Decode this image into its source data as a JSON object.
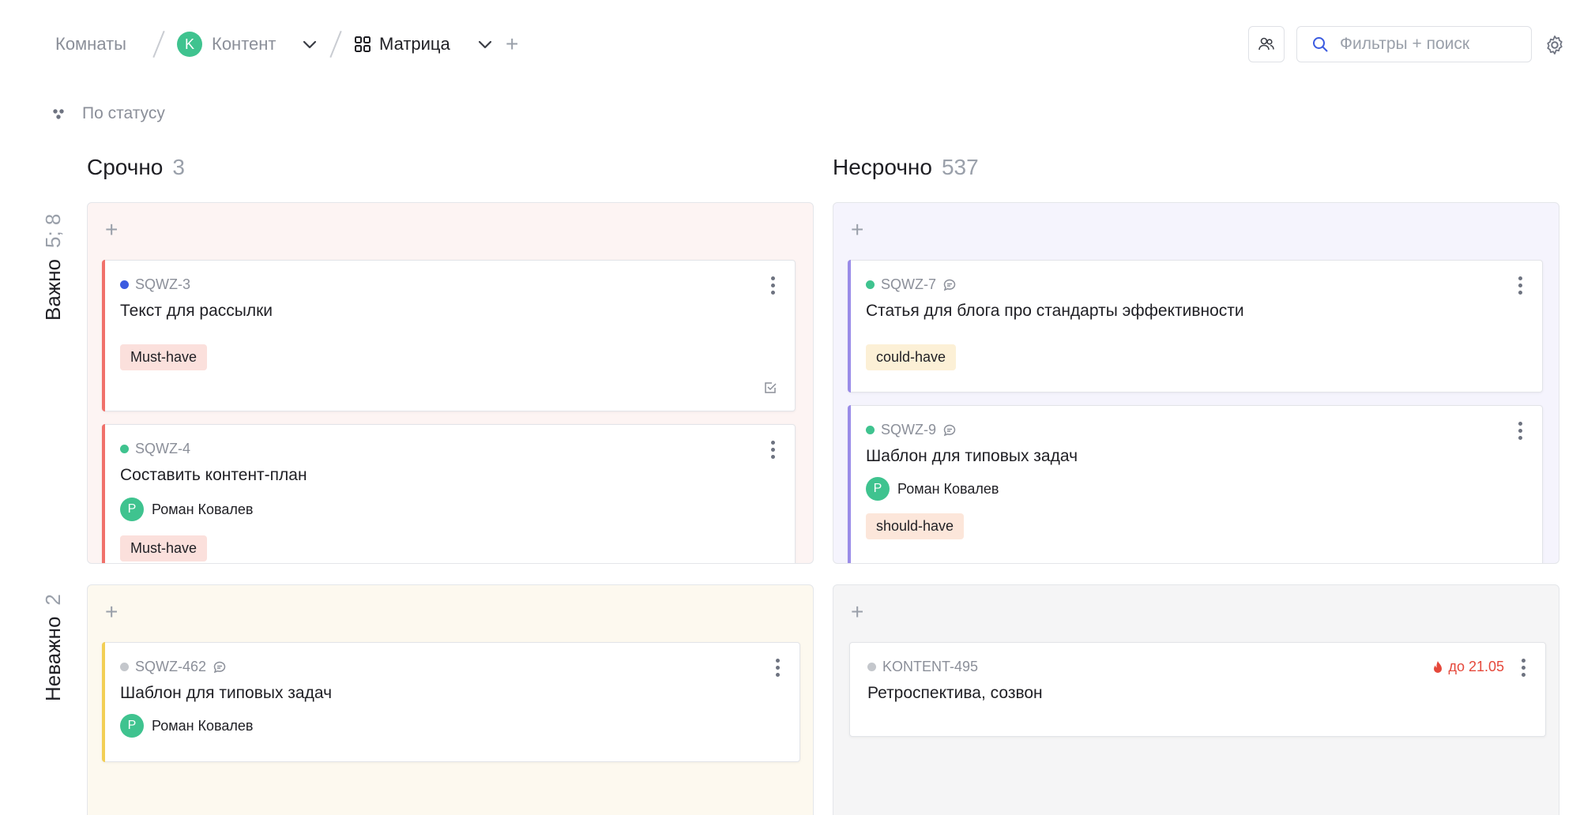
{
  "header": {
    "rooms": "Комнаты",
    "content_badge": "K",
    "content": "Контент",
    "matrix": "Матрица",
    "search_placeholder": "Фильтры + поиск"
  },
  "grouping": "По статусу",
  "columns": [
    {
      "title": "Срочно",
      "count": "3"
    },
    {
      "title": "Несрочно",
      "count": "537"
    }
  ],
  "rows": [
    {
      "title": "Важно",
      "count": "5",
      "extra": "8"
    },
    {
      "title": "Неважно",
      "count": "2"
    }
  ],
  "cards": [
    {
      "id": "SQWZ-3",
      "title": "Текст для рассылки",
      "tag": "Must-have"
    },
    {
      "id": "SQWZ-4",
      "title": "Составить контент-план",
      "assignee_initial": "P",
      "assignee": "Роман Ковалев",
      "tag": "Must-have"
    },
    {
      "id": "SQWZ-7",
      "title": "Статья для блога про стандарты эффективности",
      "tag": "could-have"
    },
    {
      "id": "SQWZ-9",
      "title": "Шаблон для типовых задач",
      "assignee_initial": "P",
      "assignee": "Роман Ковалев",
      "tag": "should-have"
    },
    {
      "id": "SQWZ-462",
      "title": "Шаблон для типовых задач",
      "assignee_initial": "P",
      "assignee": "Роман Ковалев"
    },
    {
      "id": "KONTENT-495",
      "title": "Ретроспектива, созвон",
      "deadline": "до 21.05"
    }
  ],
  "colors": {
    "accent_green": "#3fc38f",
    "status_blue": "#3b5be0",
    "status_green": "#3fc38f",
    "status_gray": "#c4c7cc",
    "bar_red": "#f0716b",
    "bar_violet": "#9a8ce8",
    "bar_yellow": "#f2cf55",
    "deadline_red": "#e5483b"
  }
}
